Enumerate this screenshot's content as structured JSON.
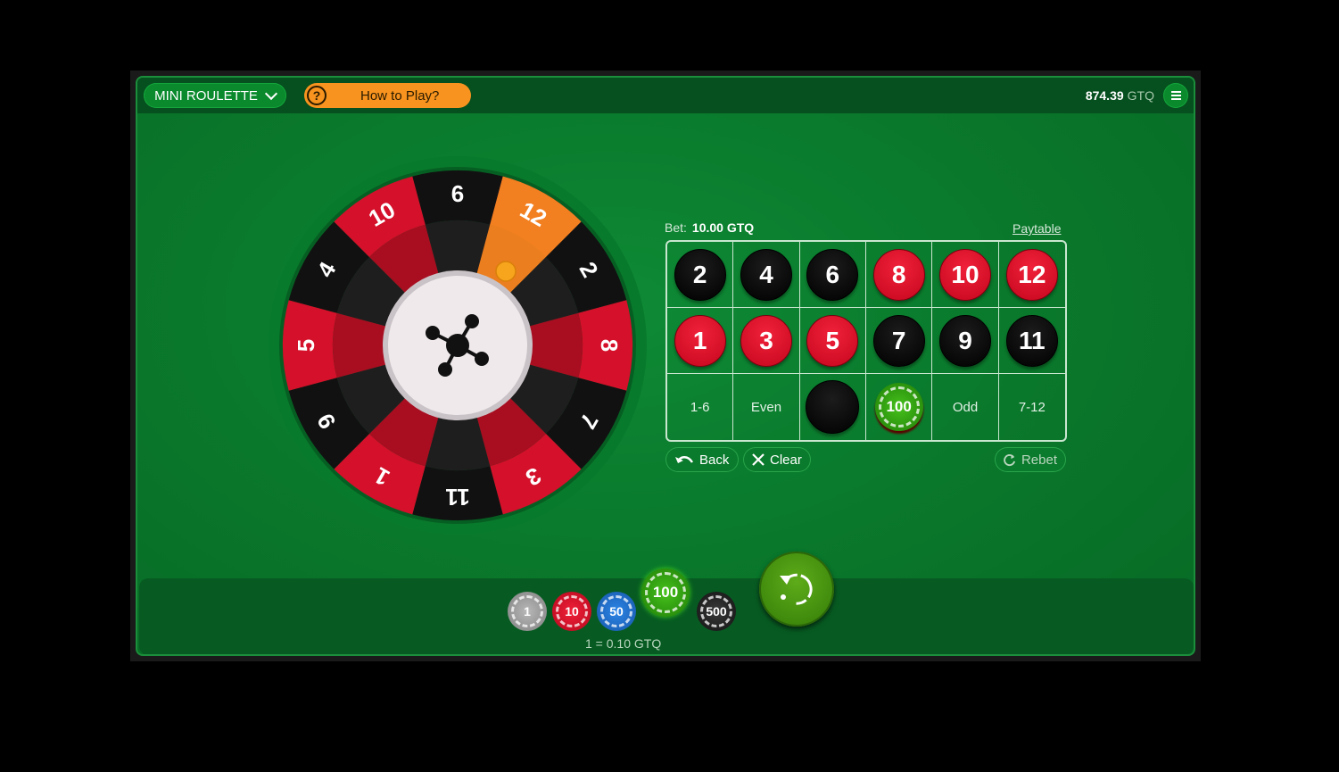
{
  "header": {
    "game_name": "MINI ROULETTE",
    "how_to_play": "How to Play?",
    "balance": "874.39",
    "currency": "GTQ"
  },
  "wheel": {
    "numbers": [
      {
        "n": "6",
        "color": "black"
      },
      {
        "n": "12",
        "color": "red",
        "highlighted": true
      },
      {
        "n": "2",
        "color": "black"
      },
      {
        "n": "8",
        "color": "red"
      },
      {
        "n": "7",
        "color": "black"
      },
      {
        "n": "3",
        "color": "red"
      },
      {
        "n": "11",
        "color": "black"
      },
      {
        "n": "1",
        "color": "red"
      },
      {
        "n": "9",
        "color": "black"
      },
      {
        "n": "5",
        "color": "red"
      },
      {
        "n": "4",
        "color": "black"
      },
      {
        "n": "10",
        "color": "red"
      }
    ],
    "hub_icon": "molecule-icon",
    "ball_color": "#f7a51c"
  },
  "board": {
    "bet_label": "Bet:",
    "bet_value": "10.00 GTQ",
    "paytable": "Paytable",
    "row1": [
      {
        "n": "2",
        "color": "black"
      },
      {
        "n": "4",
        "color": "black"
      },
      {
        "n": "6",
        "color": "black"
      },
      {
        "n": "8",
        "color": "red"
      },
      {
        "n": "10",
        "color": "red"
      },
      {
        "n": "12",
        "color": "red"
      }
    ],
    "row2": [
      {
        "n": "1",
        "color": "red"
      },
      {
        "n": "3",
        "color": "red"
      },
      {
        "n": "5",
        "color": "red"
      },
      {
        "n": "7",
        "color": "black"
      },
      {
        "n": "9",
        "color": "black"
      },
      {
        "n": "11",
        "color": "black"
      }
    ],
    "row3": {
      "low": "1-6",
      "even": "Even",
      "black_bet": "",
      "red_bet_chip": "100",
      "odd": "Odd",
      "high": "7-12"
    },
    "back": "Back",
    "clear": "Clear",
    "rebet": "Rebet"
  },
  "chips": [
    {
      "value": "1",
      "color": "#9a9a9a"
    },
    {
      "value": "10",
      "color": "#d9102a"
    },
    {
      "value": "50",
      "color": "#1e6fd0"
    },
    {
      "value": "100",
      "color": "#2fa50f",
      "selected": true
    },
    {
      "value": "500",
      "color": "#2a2a2a"
    }
  ],
  "rate": "1 = 0.10 GTQ",
  "colors": {
    "red": "#d4102a",
    "black": "#111111",
    "felt": "#0a7a2c",
    "accent": "#f7931e"
  }
}
